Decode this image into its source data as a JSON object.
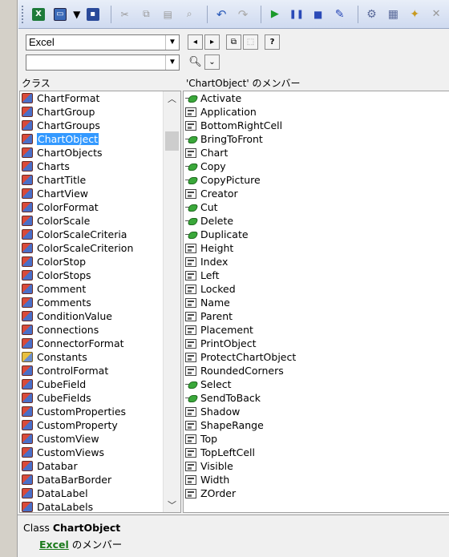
{
  "toolbar": {
    "icons": [
      "excel-icon",
      "userform-icon",
      "dropdown-icon",
      "save-icon",
      "cut-icon",
      "copy-icon",
      "paste-icon",
      "find-icon",
      "undo-icon",
      "redo-icon",
      "run-icon",
      "break-icon",
      "reset-icon",
      "design-mode-icon",
      "project-explorer-icon",
      "properties-icon",
      "object-browser-icon",
      "toolbox-icon"
    ]
  },
  "library_combo": {
    "value": "Excel"
  },
  "search_combo": {
    "value": ""
  },
  "header": {
    "classes_label": "クラス",
    "members_label": "'ChartObject' のメンバー"
  },
  "classes": [
    {
      "label": "ChartFormat",
      "icon": "class"
    },
    {
      "label": "ChartGroup",
      "icon": "class"
    },
    {
      "label": "ChartGroups",
      "icon": "class"
    },
    {
      "label": "ChartObject",
      "icon": "class",
      "selected": true
    },
    {
      "label": "ChartObjects",
      "icon": "class"
    },
    {
      "label": "Charts",
      "icon": "class"
    },
    {
      "label": "ChartTitle",
      "icon": "class"
    },
    {
      "label": "ChartView",
      "icon": "class"
    },
    {
      "label": "ColorFormat",
      "icon": "class"
    },
    {
      "label": "ColorScale",
      "icon": "class"
    },
    {
      "label": "ColorScaleCriteria",
      "icon": "class"
    },
    {
      "label": "ColorScaleCriterion",
      "icon": "class"
    },
    {
      "label": "ColorStop",
      "icon": "class"
    },
    {
      "label": "ColorStops",
      "icon": "class"
    },
    {
      "label": "Comment",
      "icon": "class"
    },
    {
      "label": "Comments",
      "icon": "class"
    },
    {
      "label": "ConditionValue",
      "icon": "class"
    },
    {
      "label": "Connections",
      "icon": "class"
    },
    {
      "label": "ConnectorFormat",
      "icon": "class"
    },
    {
      "label": "Constants",
      "icon": "const"
    },
    {
      "label": "ControlFormat",
      "icon": "class"
    },
    {
      "label": "CubeField",
      "icon": "class"
    },
    {
      "label": "CubeFields",
      "icon": "class"
    },
    {
      "label": "CustomProperties",
      "icon": "class"
    },
    {
      "label": "CustomProperty",
      "icon": "class"
    },
    {
      "label": "CustomView",
      "icon": "class"
    },
    {
      "label": "CustomViews",
      "icon": "class"
    },
    {
      "label": "Databar",
      "icon": "class"
    },
    {
      "label": "DataBarBorder",
      "icon": "class"
    },
    {
      "label": "DataLabel",
      "icon": "class"
    },
    {
      "label": "DataLabels",
      "icon": "class"
    }
  ],
  "members": [
    {
      "label": "Activate",
      "icon": "method"
    },
    {
      "label": "Application",
      "icon": "prop"
    },
    {
      "label": "BottomRightCell",
      "icon": "prop"
    },
    {
      "label": "BringToFront",
      "icon": "method"
    },
    {
      "label": "Chart",
      "icon": "prop"
    },
    {
      "label": "Copy",
      "icon": "method"
    },
    {
      "label": "CopyPicture",
      "icon": "method"
    },
    {
      "label": "Creator",
      "icon": "prop"
    },
    {
      "label": "Cut",
      "icon": "method"
    },
    {
      "label": "Delete",
      "icon": "method"
    },
    {
      "label": "Duplicate",
      "icon": "method"
    },
    {
      "label": "Height",
      "icon": "prop"
    },
    {
      "label": "Index",
      "icon": "prop"
    },
    {
      "label": "Left",
      "icon": "prop"
    },
    {
      "label": "Locked",
      "icon": "prop"
    },
    {
      "label": "Name",
      "icon": "prop"
    },
    {
      "label": "Parent",
      "icon": "prop"
    },
    {
      "label": "Placement",
      "icon": "prop"
    },
    {
      "label": "PrintObject",
      "icon": "prop"
    },
    {
      "label": "ProtectChartObject",
      "icon": "prop"
    },
    {
      "label": "RoundedCorners",
      "icon": "prop"
    },
    {
      "label": "Select",
      "icon": "method"
    },
    {
      "label": "SendToBack",
      "icon": "method"
    },
    {
      "label": "Shadow",
      "icon": "prop"
    },
    {
      "label": "ShapeRange",
      "icon": "prop"
    },
    {
      "label": "Top",
      "icon": "prop"
    },
    {
      "label": "TopLeftCell",
      "icon": "prop"
    },
    {
      "label": "Visible",
      "icon": "prop"
    },
    {
      "label": "Width",
      "icon": "prop"
    },
    {
      "label": "ZOrder",
      "icon": "prop"
    }
  ],
  "info": {
    "class_prefix": "Class ",
    "class_name": "ChartObject",
    "library_link": "Excel",
    "member_of_suffix": " のメンバー"
  },
  "colors": {
    "selection": "#3399ff",
    "link": "#1a7a1a"
  }
}
